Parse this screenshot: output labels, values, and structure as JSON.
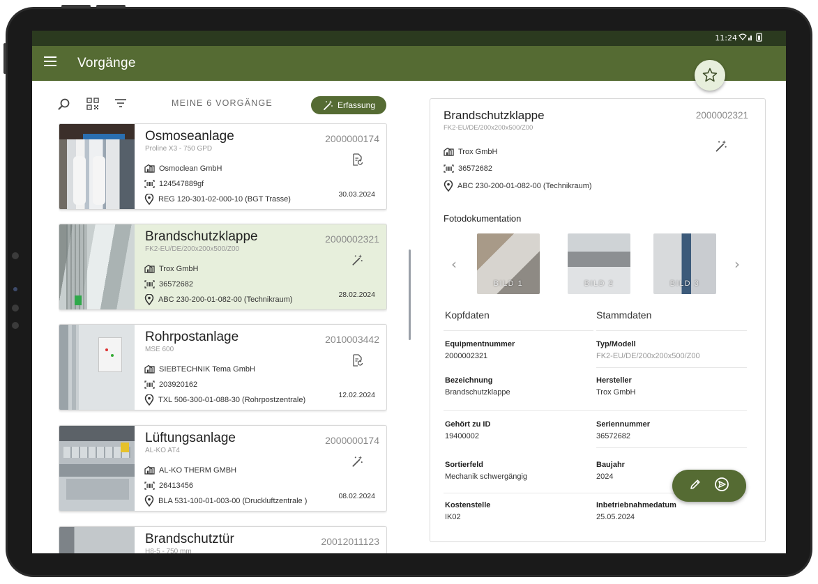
{
  "status": {
    "time": "11:24",
    "icons": "wifi-signal-battery"
  },
  "appbar": {
    "title": "Vorgänge"
  },
  "toolbar": {
    "title": "MEINE 6 VORGÄNGE",
    "erfassung_label": "Erfassung"
  },
  "cards": [
    {
      "name": "Osmoseanlage",
      "model": "Proline X3 - 750 GPD",
      "number": "2000000174",
      "company": "Osmoclean GmbH",
      "serial": "124547889gf",
      "location": "REG 120-301-02-000-10 (BGT Trasse)",
      "date": "30.03.2024",
      "action_icon": "document-refresh-icon",
      "selected": false
    },
    {
      "name": "Brandschutzklappe",
      "model": "FK2-EU/DE/200x200x500/Z00",
      "number": "2000002321",
      "company": "Trox GmbH",
      "serial": "36572682",
      "location": "ABC 230-200-01-082-00 (Technikraum)",
      "date": "28.02.2024",
      "action_icon": "magic-wand-icon",
      "selected": true
    },
    {
      "name": "Rohrpostanlage",
      "model": "MSE 600",
      "number": "2010003442",
      "company": "SIEBTECHNIK Tema GmbH",
      "serial": "203920162",
      "location": "TXL 506-300-01-088-30 (Rohrpostzentrale)",
      "date": "12.02.2024",
      "action_icon": "document-refresh-icon",
      "selected": false
    },
    {
      "name": "Lüftungsanlage",
      "model": "AL-KO AT4",
      "number": "2000000174",
      "company": "AL-KO THERM GMBH",
      "serial": "26413456",
      "location": "BLA 531-100-01-003-00 (Druckluftzentrale )",
      "date": "08.02.2024",
      "action_icon": "magic-wand-icon",
      "selected": false
    },
    {
      "name": "Brandschutztür",
      "model": "H8-5 - 750 mm",
      "number": "20012011123",
      "company": "",
      "serial": "",
      "location": "",
      "date": "",
      "action_icon": "",
      "selected": false
    }
  ],
  "detail": {
    "title": "Brandschutzklappe",
    "model": "FK2-EU/DE/200x200x500/Z00",
    "number": "2000002321",
    "company": "Trox GmbH",
    "serial": "36572682",
    "location": "ABC 230-200-01-082-00 (Technikraum)",
    "foto_heading": "Fotodokumentation",
    "photos": [
      "BILD 1",
      "BILD 2",
      "BILD 3"
    ],
    "tab_kopf": "Kopfdaten",
    "tab_stamm": "Stammdaten",
    "fields": [
      {
        "label": "Equipmentnummer",
        "value": "2000002321"
      },
      {
        "label": "Typ/Modell",
        "value": "FK2-EU/DE/200x200x500/Z00"
      },
      {
        "label": "Bezeichnung",
        "value": "Brandschutzklappe"
      },
      {
        "label": "Hersteller",
        "value": "Trox GmbH"
      },
      {
        "label": "Gehört zu ID",
        "value": "19400002"
      },
      {
        "label": "Seriennummer",
        "value": "36572682"
      },
      {
        "label": "Sortierfeld",
        "value": "Mechanik schwergängig"
      },
      {
        "label": "Baujahr",
        "value": "2024"
      },
      {
        "label": "Kostenstelle",
        "value": "IK02"
      },
      {
        "label": "Inbetriebnahmedatum",
        "value": "25.05.2024"
      }
    ]
  },
  "colors": {
    "primary": "#556b33",
    "statusbar": "#2b3a1f",
    "selected_card": "#e7efdc"
  }
}
